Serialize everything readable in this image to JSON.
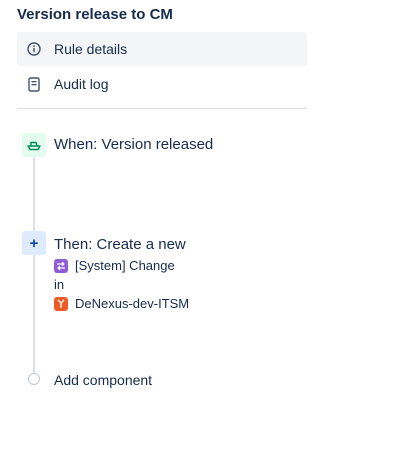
{
  "page": {
    "title": "Version release to CM"
  },
  "nav": {
    "items": [
      {
        "label": "Rule details",
        "icon": "info-icon",
        "active": true
      },
      {
        "label": "Audit log",
        "icon": "document-icon",
        "active": false
      }
    ]
  },
  "rule": {
    "trigger": {
      "label": "When: Version released",
      "icon": "ship-icon",
      "icon_bg": "#e3fcef",
      "icon_color": "#00875a"
    },
    "action": {
      "label": "Then: Create a new",
      "icon": "plus-icon",
      "icon_bg": "#deebff",
      "icon_glyph": "+",
      "issue_type": "[System] Change",
      "issue_type_icon": "change-type-icon",
      "connector": "in",
      "project": "DeNexus-dev-ITSM",
      "project_icon": "project-avatar-icon"
    },
    "add_component": {
      "label": "Add component"
    }
  }
}
